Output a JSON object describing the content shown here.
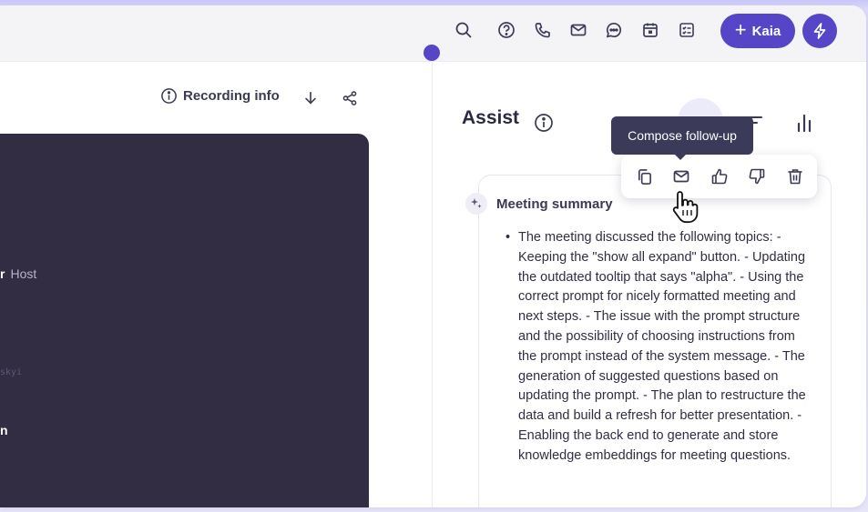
{
  "topbar": {
    "icons": [
      "search-icon",
      "help-icon",
      "phone-icon",
      "mail-icon",
      "chat-icon",
      "calendar-icon",
      "checklist-icon"
    ],
    "kaia_label": "Kaia",
    "kaia_plus": "+",
    "accent": "#5646c7"
  },
  "left": {
    "recording_info_label": "Recording info",
    "host_name": "r",
    "host_label": "Host",
    "faint_text": "skyi",
    "partial_name": "n",
    "panel_color": "#322d42"
  },
  "assist": {
    "title": "Assist",
    "tooltip": "Compose follow-up",
    "actions": [
      "copy-icon",
      "mail-icon",
      "thumbs-up-icon",
      "thumbs-down-icon",
      "trash-icon"
    ],
    "summary_title": "Meeting summary",
    "summary_bullet": "•",
    "summary_text": "The meeting discussed the following topics: - Keeping the \"show all expand\" button. - Updating the outdated tooltip that says \"alpha\". - Using the correct prompt for nicely formatted meeting and next steps. - The issue with the prompt structure and the possibility of choosing instructions from the prompt instead of the system message. - The generation of suggested questions based on updating the prompt. - The plan to restructure the data and build a refresh for better presentation. - Enabling the back end to generate and store knowledge embeddings for meeting questions."
  }
}
